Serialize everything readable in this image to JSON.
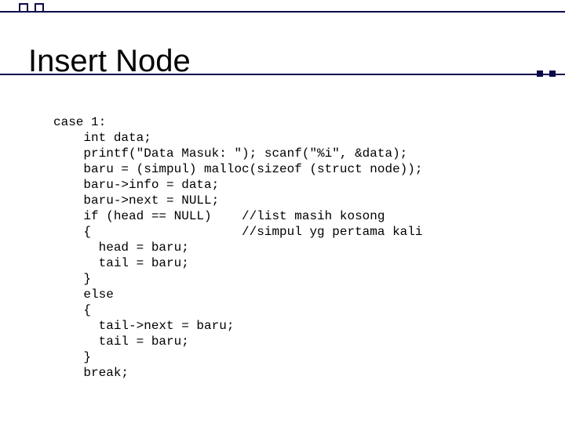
{
  "title": "Insert Node",
  "code": "case 1:\n    int data;\n    printf(\"Data Masuk: \"); scanf(\"%i\", &data);\n    baru = (simpul) malloc(sizeof (struct node));\n    baru->info = data;\n    baru->next = NULL;\n    if (head == NULL)    //list masih kosong\n    {                    //simpul yg pertama kali\n      head = baru;\n      tail = baru;\n    }\n    else\n    {\n      tail->next = baru;\n      tail = baru;\n    }\n    break;"
}
